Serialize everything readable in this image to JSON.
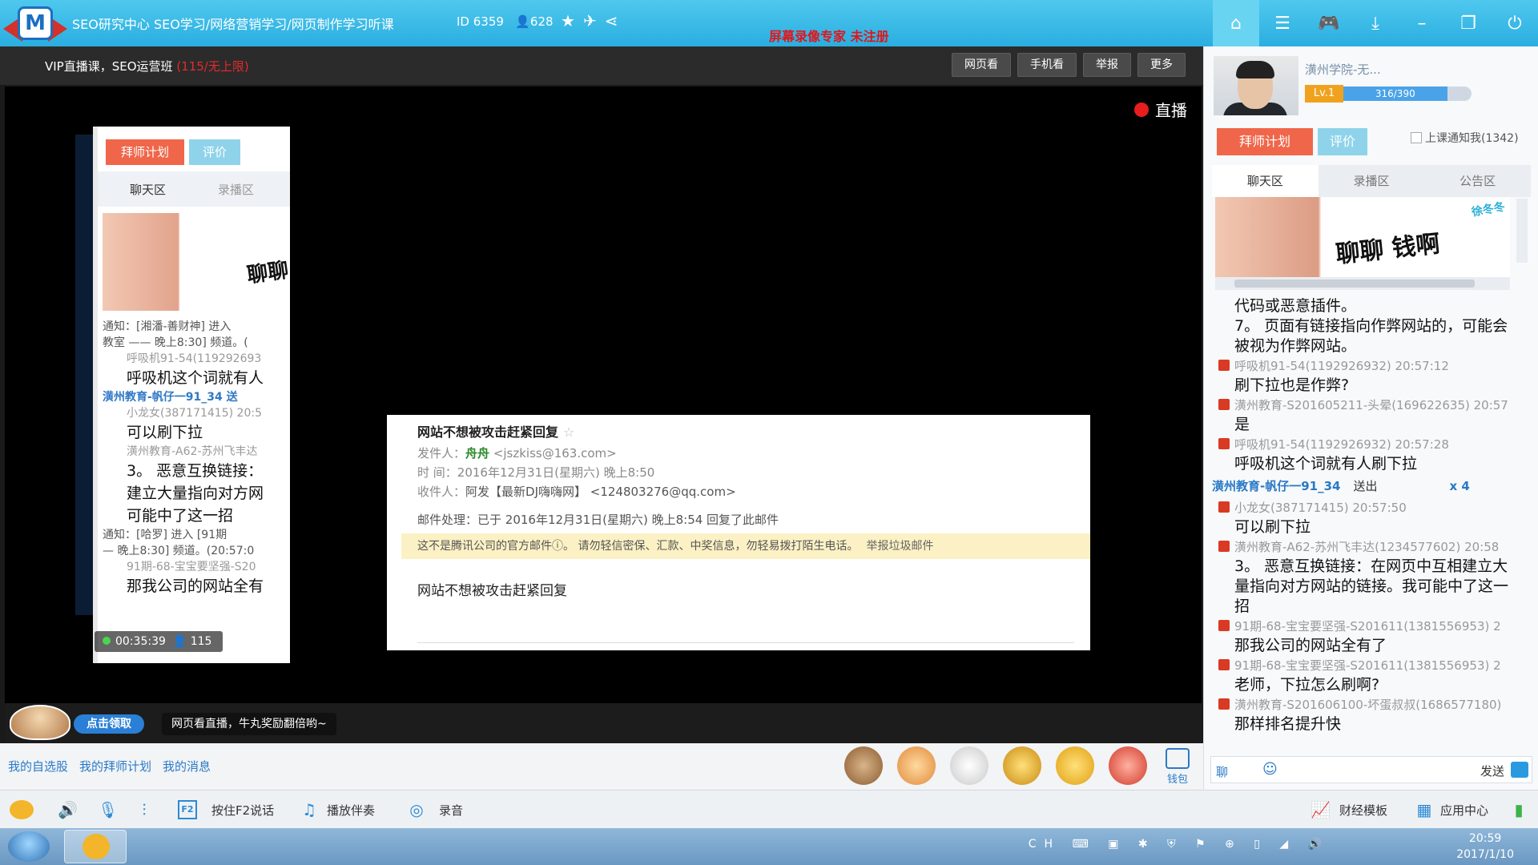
{
  "window": {
    "title": "SEO研究中心 SEO学习/网络营销学习/网页制作学习听课",
    "room_id": "ID 6359",
    "viewer_count": "628",
    "recorder_label": "屏幕录像专家   未注册"
  },
  "header": {
    "course_title": "VIP直播课，SEO运营班",
    "course_limit": "(115/无上限)",
    "buttons": [
      "网页看",
      "手机看",
      "举报",
      "更多"
    ]
  },
  "video": {
    "live_label": "直播"
  },
  "inner_screen": {
    "btn_plan": "拜师计划",
    "btn_rate": "评价",
    "tab_chat": "聊天区",
    "tab_record": "录播区",
    "ad_text": "聊聊",
    "lines": [
      {
        "type": "notice",
        "text": "通知：[湘潘-善财神] 进入"
      },
      {
        "type": "notice",
        "text": "教室 —— 晚上8:30] 频道。("
      },
      {
        "type": "gray",
        "text": "呼吸机91-54(119292693"
      },
      {
        "type": "big",
        "text": "呼吸机这个词就有人"
      },
      {
        "type": "blue",
        "text": "潢州教育-帆仔一91_34   送"
      },
      {
        "type": "gray",
        "text": "小龙女(387171415) 20:5"
      },
      {
        "type": "big",
        "text": "可以刷下拉"
      },
      {
        "type": "gray",
        "text": "潢州教育-A62-苏州飞丰达"
      },
      {
        "type": "big",
        "text": "3。 恶意互换链接："
      },
      {
        "type": "big",
        "text": "建立大量指向对方网"
      },
      {
        "type": "big",
        "text": "可能中了这一招"
      },
      {
        "type": "notice",
        "text": "通知：[哈罗] 进入 [91期"
      },
      {
        "type": "notice",
        "text": "— 晚上8:30] 频道。(20:57:0"
      },
      {
        "type": "gray",
        "text": "91期-68-宝宝要坚强-S20"
      },
      {
        "type": "big",
        "text": "那我公司的网站全有"
      }
    ],
    "status_time": "00:35:39",
    "status_count": "115"
  },
  "email": {
    "subject": "网站不想被攻击赶紧回复",
    "sender_label": "发件人：",
    "sender_name": "舟舟",
    "sender_email": "<jszkiss@163.com>",
    "time_label": "时   间：",
    "time_value": "2016年12月31日(星期六) 晚上8:50",
    "recipient_label": "收件人：",
    "recipient_value": "阿发【最新DJ嗨嗨网】 <124803276@qq.com>",
    "handle_label": "邮件处理：",
    "handle_value": "已于 2016年12月31日(星期六) 晚上8:54 回复了此邮件",
    "warning": "这不是腾讯公司的官方邮件ⓘ。 请勿轻信密保、汇款、中奖信息，勿轻易拨打陌生电话。",
    "report_link": "举报垃圾邮件",
    "body": "网站不想被攻击赶紧回复"
  },
  "promo": {
    "claim_label": "点击领取",
    "tip": "网页看直播，牛丸奖励翻倍哟~"
  },
  "links": [
    "我的自选股",
    "我的拜师计划",
    "我的消息"
  ],
  "wallet_label": "钱包",
  "right_panel": {
    "teacher_name": "潢州学院-无...",
    "level": "Lv.1",
    "exp": "316/390",
    "exp_fraction": 0.81,
    "btn_plan": "拜师计划",
    "btn_rate": "评价",
    "notify_label": "上课通知我(1342)",
    "tabs": [
      "聊天区",
      "录播区",
      "公告区"
    ],
    "ad_text": "聊聊 钱啊",
    "ad_badge": "徐冬冬",
    "chat": [
      {
        "kind": "msg",
        "text": "代码或恶意插件。"
      },
      {
        "kind": "msg",
        "text": "   7。 页面有链接指向作弊网站的，可能会被视为作弊网站。"
      },
      {
        "kind": "meta",
        "text": "呼吸机91-54(1192926932) 20:57:12"
      },
      {
        "kind": "msg",
        "text": "刷下拉也是作弊?"
      },
      {
        "kind": "meta",
        "text": "潢州教育-S201605211-头晕(169622635) 20:57"
      },
      {
        "kind": "msg",
        "text": "是"
      },
      {
        "kind": "meta",
        "text": "呼吸机91-54(1192926932) 20:57:28"
      },
      {
        "kind": "msg",
        "text": "呼吸机这个词就有人刷下拉"
      },
      {
        "kind": "gift",
        "name": "潢州教育-帆仔一91_34",
        "action": "送出",
        "count": "x 4"
      },
      {
        "kind": "meta",
        "text": "小龙女(387171415) 20:57:50"
      },
      {
        "kind": "msg",
        "text": "可以刷下拉"
      },
      {
        "kind": "meta",
        "text": "潢州教育-A62-苏州飞丰达(1234577602) 20:58"
      },
      {
        "kind": "msg",
        "text": "3。 恶意互换链接：在网页中互相建立大量指向对方网站的链接。我可能中了这一招"
      },
      {
        "kind": "meta",
        "text": "91期-68-宝宝要坚强-S201611(1381556953) 2"
      },
      {
        "kind": "msg",
        "text": "那我公司的网站全有了"
      },
      {
        "kind": "meta",
        "text": "91期-68-宝宝要坚强-S201611(1381556953) 2"
      },
      {
        "kind": "msg",
        "text": "老师，下拉怎么刷啊?"
      },
      {
        "kind": "meta",
        "text": "潢州教育-S201606100-坏蛋叔叔(1686577180)"
      },
      {
        "kind": "msg",
        "text": "那样排名提升快"
      }
    ],
    "input_tab": "聊",
    "send_label": "发送"
  },
  "toolbar": {
    "f2_label": "按住F2说话",
    "accompany_label": "播放伴奏",
    "record_label": "录音",
    "finance_label": "财经模板",
    "app_center_label": "应用中心"
  },
  "taskbar": {
    "ime": "CH",
    "time": "20:59",
    "date": "2017/1/10"
  }
}
